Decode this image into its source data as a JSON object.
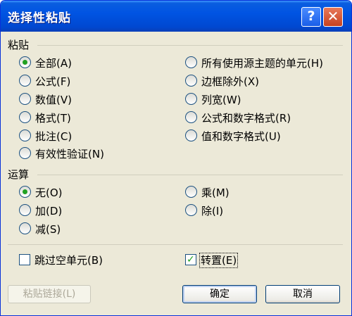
{
  "dialog": {
    "title": "选择性粘贴",
    "help_glyph": "?",
    "close_glyph": "✕"
  },
  "paste": {
    "heading": "粘贴",
    "options": [
      {
        "label": "全部(A)",
        "selected": true
      },
      {
        "label": "公式(F)",
        "selected": false
      },
      {
        "label": "数值(V)",
        "selected": false
      },
      {
        "label": "格式(T)",
        "selected": false
      },
      {
        "label": "批注(C)",
        "selected": false
      },
      {
        "label": "有效性验证(N)",
        "selected": false
      },
      {
        "label": "所有使用源主题的单元(H)",
        "selected": false
      },
      {
        "label": "边框除外(X)",
        "selected": false
      },
      {
        "label": "列宽(W)",
        "selected": false
      },
      {
        "label": "公式和数字格式(R)",
        "selected": false
      },
      {
        "label": "值和数字格式(U)",
        "selected": false
      }
    ]
  },
  "operation": {
    "heading": "运算",
    "options": [
      {
        "label": "无(O)",
        "selected": true
      },
      {
        "label": "加(D)",
        "selected": false
      },
      {
        "label": "减(S)",
        "selected": false
      },
      {
        "label": "乘(M)",
        "selected": false
      },
      {
        "label": "除(I)",
        "selected": false
      }
    ]
  },
  "checks": {
    "skip_blanks": {
      "label": "跳过空单元(B)",
      "checked": false
    },
    "transpose": {
      "label": "转置(E)",
      "checked": true
    }
  },
  "buttons": {
    "paste_link": "粘贴链接(L)",
    "ok": "确定",
    "cancel": "取消"
  },
  "colors": {
    "titlebar": "#0054e3",
    "dialog_bg": "#ece9d8",
    "radio_dot": "#21a121"
  }
}
